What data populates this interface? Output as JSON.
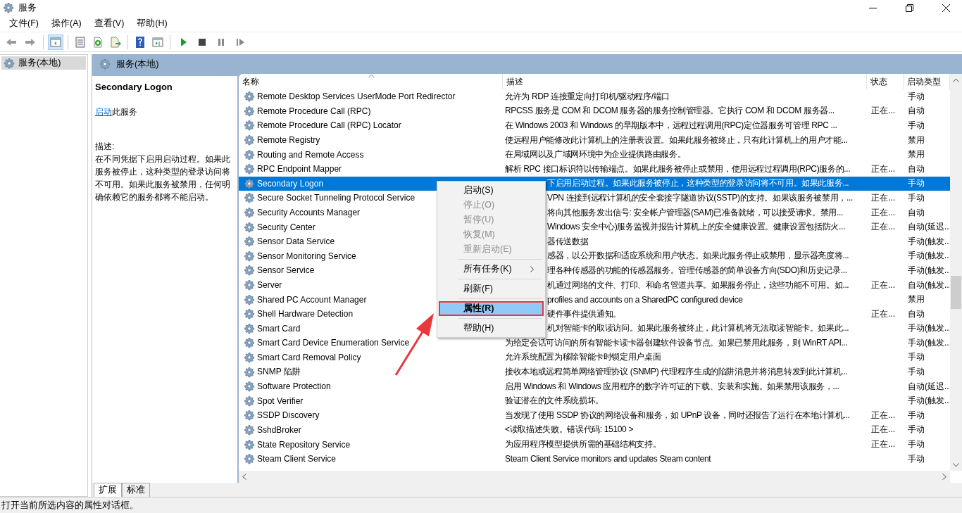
{
  "window": {
    "title": "服务"
  },
  "menu_bar": [
    "文件(F)",
    "操作(A)",
    "查看(V)",
    "帮助(H)"
  ],
  "toolbar": {
    "console_tree_pressed": true
  },
  "tree": {
    "items": [
      {
        "label": "服务(本地)",
        "selected": true
      }
    ]
  },
  "panel": {
    "title": "服务(本地)"
  },
  "details": {
    "service_name": "Secondary Logon",
    "action_link": "启动",
    "action_rest": "此服务",
    "description_label": "描述:",
    "description": "在不同凭据下启用启动过程。如果此服务被停止，这种类型的登录访问将不可用。如果此服务被禁用，任何明确依赖它的服务都将不能启动。"
  },
  "table": {
    "columns": [
      "名称",
      "描述",
      "状态",
      "启动类型"
    ],
    "rows": [
      {
        "name": "Remote Desktop Services UserMode Port Redirector",
        "description": "允许为 RDP 连接重定向打印机/驱动程序/端口",
        "status": "",
        "startup": "手动",
        "selected": false,
        "desc_covered": false
      },
      {
        "name": "Remote Procedure Call (RPC)",
        "description": "RPCSS 服务是 COM 和 DCOM 服务器的服务控制管理器。它执行 COM 和 DCOM 服务器...",
        "status": "正在...",
        "startup": "自动",
        "selected": false,
        "desc_covered": false
      },
      {
        "name": "Remote Procedure Call (RPC) Locator",
        "description": "在 Windows 2003 和 Windows 的早期版本中，远程过程调用(RPC)定位器服务可管理 RPC ...",
        "status": "",
        "startup": "手动",
        "selected": false,
        "desc_covered": false
      },
      {
        "name": "Remote Registry",
        "description": "使远程用户能修改此计算机上的注册表设置。如果此服务被终止，只有此计算机上的用户才能...",
        "status": "",
        "startup": "禁用",
        "selected": false,
        "desc_covered": false
      },
      {
        "name": "Routing and Remote Access",
        "description": "在局域网以及广域网环境中为企业提供路由服务。",
        "status": "",
        "startup": "禁用",
        "selected": false,
        "desc_covered": false
      },
      {
        "name": "RPC Endpoint Mapper",
        "description": "解析 RPC 接口标识符以传输端点。如果此服务被停止或禁用，使用远程过程调用(RPC)服务的...",
        "status": "正在...",
        "startup": "自动",
        "selected": false,
        "desc_covered": false
      },
      {
        "name": "Secondary Logon",
        "description": "下启用启动过程。如果此服务被停止，这种类型的登录访问将不可用。如果此服务...",
        "status": "",
        "startup": "手动",
        "selected": true,
        "desc_covered": true
      },
      {
        "name": "Secure Socket Tunneling Protocol Service",
        "description": "VPN 连接到远程计算机的安全套接字隧道协议(SSTP)的支持。如果该服务被禁用，...",
        "status": "正在...",
        "startup": "手动",
        "selected": false,
        "desc_covered": true
      },
      {
        "name": "Security Accounts Manager",
        "description": "将向其他服务发出信号: 安全帐户管理器(SAM)已准备就绪，可以接受请求。禁用...",
        "status": "正在...",
        "startup": "自动",
        "selected": false,
        "desc_covered": true
      },
      {
        "name": "Security Center",
        "description": "Windows 安全中心)服务监视并报告计算机上的安全健康设置。健康设置包括防火...",
        "status": "正在...",
        "startup": "自动(延迟...",
        "selected": false,
        "desc_covered": true
      },
      {
        "name": "Sensor Data Service",
        "description": "器传送数据",
        "status": "",
        "startup": "手动(触发...",
        "selected": false,
        "desc_covered": true
      },
      {
        "name": "Sensor Monitoring Service",
        "description": "感器，以公开数据和适应系统和用户状态。如果此服务停止或禁用，显示器亮度将...",
        "status": "",
        "startup": "手动(触发...",
        "selected": false,
        "desc_covered": true
      },
      {
        "name": "Sensor Service",
        "description": "理各种传感器的功能的传感器服务。管理传感器的简单设备方向(SDO)和历史记录...",
        "status": "",
        "startup": "手动(触发...",
        "selected": false,
        "desc_covered": true
      },
      {
        "name": "Server",
        "description": "机通过网络的文件、打印、和命名管道共享。如果服务停止，这些功能不可用。如...",
        "status": "正在...",
        "startup": "自动(触发...",
        "selected": false,
        "desc_covered": true
      },
      {
        "name": "Shared PC Account Manager",
        "description": "profiles and accounts on a SharedPC configured device",
        "status": "",
        "startup": "禁用",
        "selected": false,
        "desc_covered": true
      },
      {
        "name": "Shell Hardware Detection",
        "description": "硬件事件提供通知。",
        "status": "正在...",
        "startup": "自动",
        "selected": false,
        "desc_covered": true
      },
      {
        "name": "Smart Card",
        "description": "机对智能卡的取读访问。如果此服务被终止，此计算机将无法取读智能卡。如果此...",
        "status": "",
        "startup": "手动(触发...",
        "selected": false,
        "desc_covered": true
      },
      {
        "name": "Smart Card Device Enumeration Service",
        "description": "为给定会话可访问的所有智能卡读卡器创建软件设备节点。如果已禁用此服务，则 WinRT API...",
        "status": "",
        "startup": "手动(触发...",
        "selected": false,
        "desc_covered": false
      },
      {
        "name": "Smart Card Removal Policy",
        "description": "允许系统配置为移除智能卡时锁定用户桌面",
        "status": "",
        "startup": "手动",
        "selected": false,
        "desc_covered": false
      },
      {
        "name": "SNMP 陷阱",
        "description": "接收本地或远程简单网络管理协议 (SNMP) 代理程序生成的陷阱消息并将消息转发到此计算机...",
        "status": "",
        "startup": "手动",
        "selected": false,
        "desc_covered": false
      },
      {
        "name": "Software Protection",
        "description": "启用 Windows 和 Windows 应用程序的数字许可证的下载、安装和实施。如果禁用该服务，...",
        "status": "",
        "startup": "自动(延迟...",
        "selected": false,
        "desc_covered": false
      },
      {
        "name": "Spot Verifier",
        "description": "验证潜在的文件系统损坏。",
        "status": "",
        "startup": "手动(触发...",
        "selected": false,
        "desc_covered": false
      },
      {
        "name": "SSDP Discovery",
        "description": "当发现了使用 SSDP 协议的网络设备和服务，如 UPnP 设备，同时还报告了运行在本地计算机...",
        "status": "正在...",
        "startup": "手动",
        "selected": false,
        "desc_covered": false
      },
      {
        "name": "SshdBroker",
        "description": "<读取描述失败。错误代码: 15100 >",
        "status": "正在...",
        "startup": "手动",
        "selected": false,
        "desc_covered": false
      },
      {
        "name": "State Repository Service",
        "description": "为应用程序模型提供所需的基础结构支持。",
        "status": "正在...",
        "startup": "手动",
        "selected": false,
        "desc_covered": false
      },
      {
        "name": "Steam Client Service",
        "description": "Steam Client Service monitors and updates Steam content",
        "status": "",
        "startup": "手动",
        "selected": false,
        "desc_covered": false
      }
    ]
  },
  "context_menu": [
    {
      "kind": "item",
      "label": "启动(S)",
      "disabled": false,
      "submenu": false,
      "default": false,
      "highlighted": false
    },
    {
      "kind": "item",
      "label": "停止(O)",
      "disabled": true,
      "submenu": false,
      "default": false,
      "highlighted": false
    },
    {
      "kind": "item",
      "label": "暂停(U)",
      "disabled": true,
      "submenu": false,
      "default": false,
      "highlighted": false
    },
    {
      "kind": "item",
      "label": "恢复(M)",
      "disabled": true,
      "submenu": false,
      "default": false,
      "highlighted": false
    },
    {
      "kind": "item",
      "label": "重新启动(E)",
      "disabled": true,
      "submenu": false,
      "default": false,
      "highlighted": false
    },
    {
      "kind": "separator"
    },
    {
      "kind": "item",
      "label": "所有任务(K)",
      "disabled": false,
      "submenu": true,
      "default": false,
      "highlighted": false
    },
    {
      "kind": "separator"
    },
    {
      "kind": "item",
      "label": "刷新(F)",
      "disabled": false,
      "submenu": false,
      "default": false,
      "highlighted": false
    },
    {
      "kind": "separator"
    },
    {
      "kind": "item",
      "label": "属性(R)",
      "disabled": false,
      "submenu": false,
      "default": true,
      "highlighted": true
    },
    {
      "kind": "separator"
    },
    {
      "kind": "item",
      "label": "帮助(H)",
      "disabled": false,
      "submenu": false,
      "default": false,
      "highlighted": false
    }
  ],
  "view_tabs": [
    {
      "label": "扩展",
      "selected": true
    },
    {
      "label": "标准",
      "selected": false
    }
  ],
  "status_bar": "打开当前所选内容的属性对话框。"
}
